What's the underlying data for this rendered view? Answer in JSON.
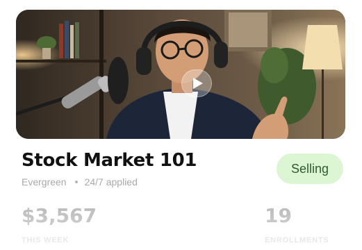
{
  "video": {
    "thumbnail_icon": "video-thumbnail-image",
    "play_icon": "play-icon"
  },
  "course": {
    "title": "Stock Market 101",
    "meta": {
      "type": "Evergreen",
      "schedule": "24/7 applied"
    },
    "status": "Selling"
  },
  "stats": [
    {
      "value": "$3,567",
      "label": "THIS WEEK"
    },
    {
      "value": "19",
      "label": "ENROLLMENTS"
    }
  ],
  "colors": {
    "status_bg": "#dcf6d3",
    "status_text": "#2f5a2f",
    "title": "#111111",
    "muted": "#a9a9a9"
  }
}
